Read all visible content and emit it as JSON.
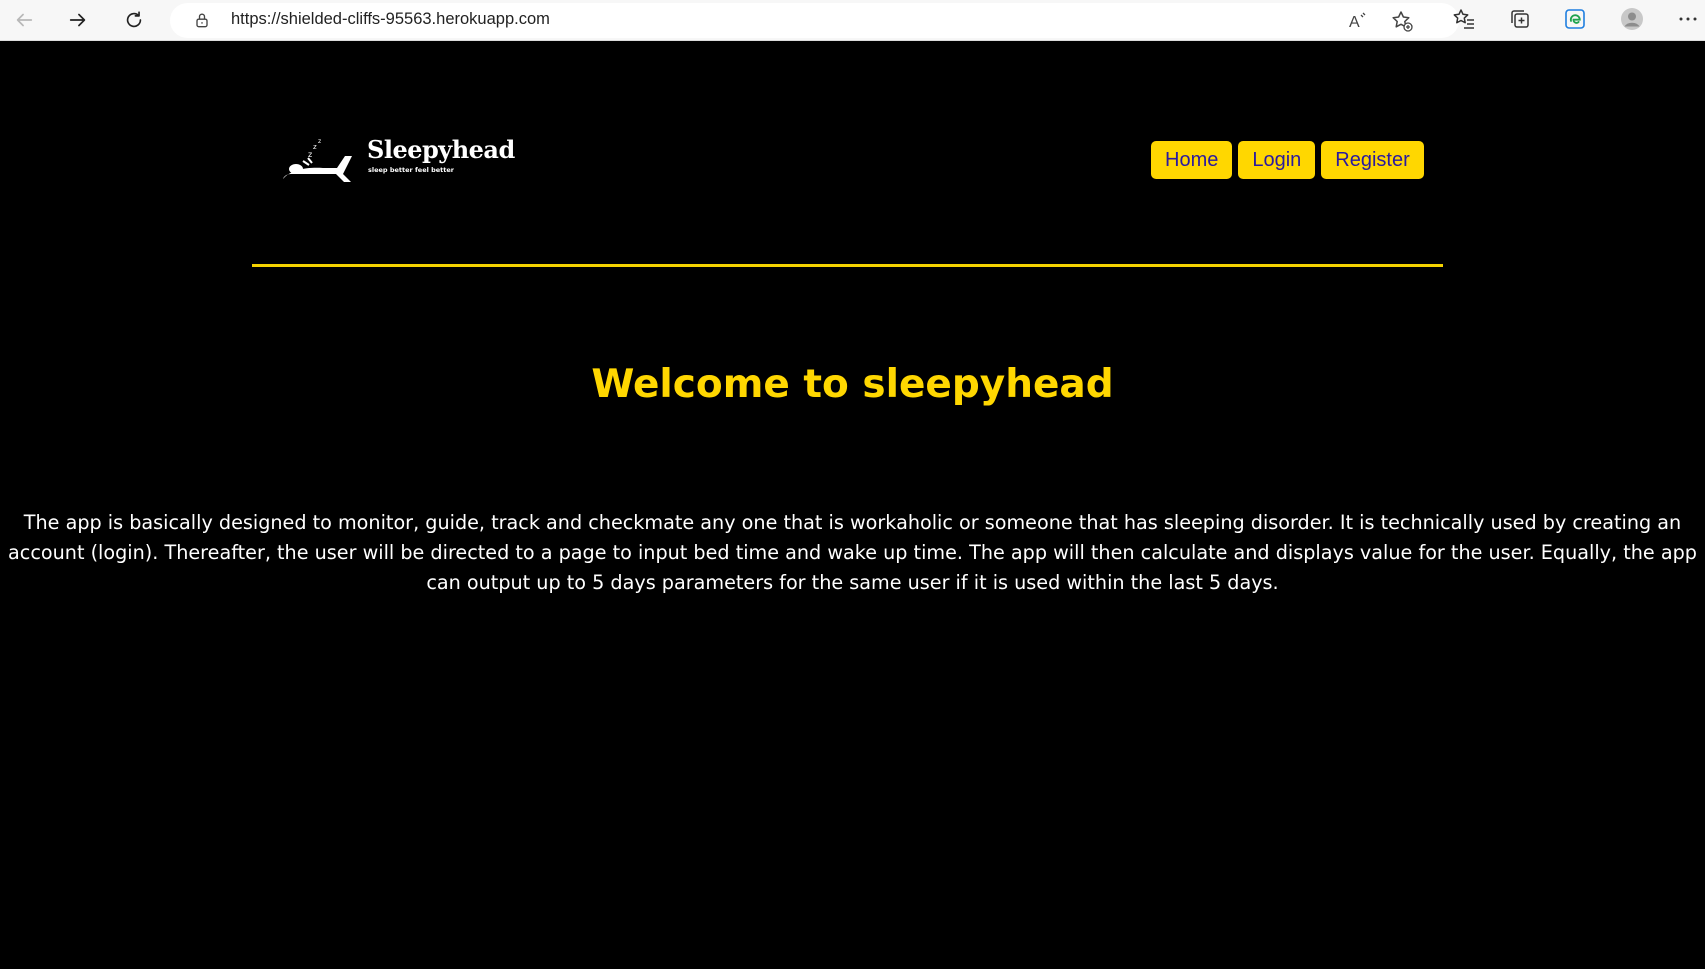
{
  "browser": {
    "url": "https://shielded-cliffs-95563.herokuapp.com",
    "icons": [
      "back-icon",
      "forward-icon",
      "refresh-icon",
      "lock-icon",
      "read-aloud-icon",
      "add-favorite-icon",
      "favorites-icon",
      "collections-icon",
      "edge-browser-icon",
      "profile-icon",
      "more-options-icon"
    ]
  },
  "site": {
    "logo_title": "Sleepyhead",
    "logo_tagline": "sleep better feel better",
    "nav": [
      "Home",
      "Login",
      "Register"
    ],
    "welcome": "Welcome to sleepyhead",
    "description": "The app is basically designed to monitor, guide, track and checkmate any one that is workaholic or someone that has sleeping disorder. It is technically used by creating an account (login). Thereafter, the user will be directed to a page to input bed time and wake up time. The app will then calculate and displays value for the user. Equally, the app can output up to 5 days parameters for the same user if it is used within the last 5 days."
  },
  "colors": {
    "background": "#000000",
    "accent": "#ffd700",
    "nav_text": "#2a1aa0",
    "body_text": "#ffffff"
  }
}
